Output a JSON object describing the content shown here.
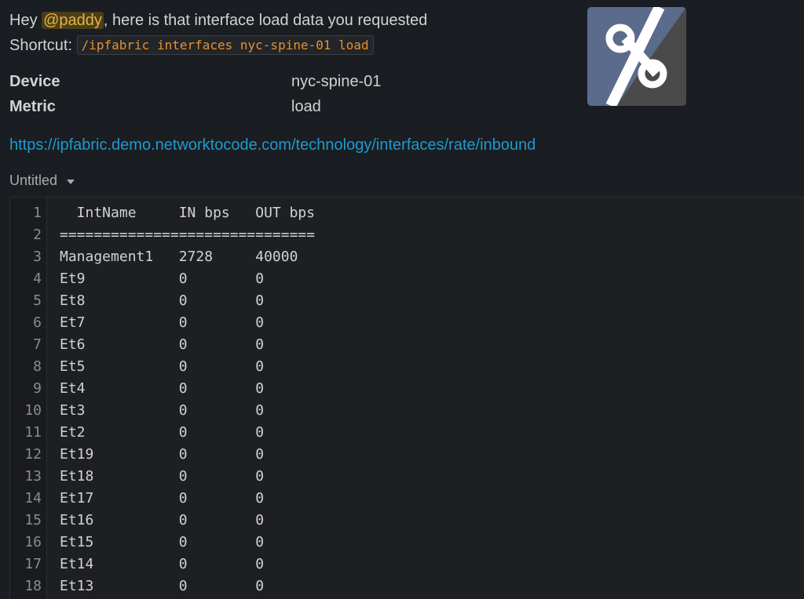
{
  "message": {
    "greeting": "Hey ",
    "mention": "@paddy",
    "text": ", here is that interface load data you requested",
    "shortcut_label": "Shortcut: ",
    "shortcut_command": "/ipfabric interfaces nyc-spine-01 load"
  },
  "fields": [
    {
      "label": "Device",
      "value": "nyc-spine-01"
    },
    {
      "label": "Metric",
      "value": "load"
    }
  ],
  "link": "https://ipfabric.demo.networktocode.com/technology/interfaces/rate/inbound",
  "logo": {
    "icon": "ipfabric-logo-icon",
    "colors": [
      "#5a6b8c",
      "#4a4a4a",
      "#ffffff"
    ]
  },
  "snippet": {
    "title": "Untitled",
    "lines": [
      {
        "n": "1",
        "text": "  IntName     IN bps   OUT bps"
      },
      {
        "n": "2",
        "text": "=============================="
      },
      {
        "n": "3",
        "text": "Management1   2728     40000"
      },
      {
        "n": "4",
        "text": "Et9           0        0"
      },
      {
        "n": "5",
        "text": "Et8           0        0"
      },
      {
        "n": "6",
        "text": "Et7           0        0"
      },
      {
        "n": "7",
        "text": "Et6           0        0"
      },
      {
        "n": "8",
        "text": "Et5           0        0"
      },
      {
        "n": "9",
        "text": "Et4           0        0"
      },
      {
        "n": "10",
        "text": "Et3           0        0"
      },
      {
        "n": "11",
        "text": "Et2           0        0"
      },
      {
        "n": "12",
        "text": "Et19          0        0"
      },
      {
        "n": "13",
        "text": "Et18          0        0"
      },
      {
        "n": "14",
        "text": "Et17          0        0"
      },
      {
        "n": "15",
        "text": "Et16          0        0"
      },
      {
        "n": "16",
        "text": "Et15          0        0"
      },
      {
        "n": "17",
        "text": "Et14          0        0"
      },
      {
        "n": "18",
        "text": "Et13          0        0"
      }
    ]
  }
}
